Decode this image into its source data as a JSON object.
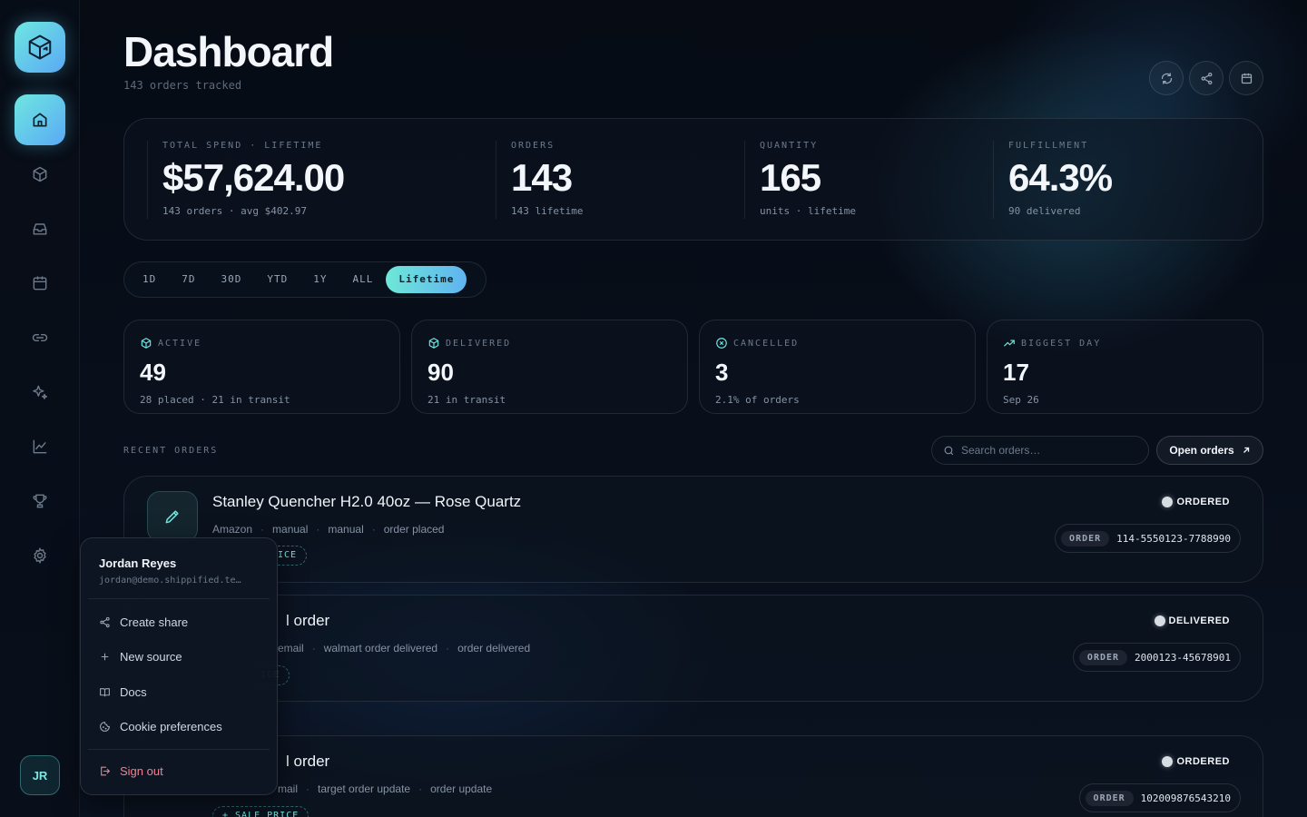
{
  "header": {
    "title": "Dashboard",
    "subtitle": "143 orders tracked"
  },
  "user": {
    "initials": "JR",
    "name": "Jordan Reyes",
    "email": "jordan@demo.shippified.te…"
  },
  "stats": [
    {
      "label": "TOTAL SPEND · LIFETIME",
      "value": "$57,624.00",
      "sub": "143 orders · avg $402.97"
    },
    {
      "label": "ORDERS",
      "value": "143",
      "sub": "143 lifetime"
    },
    {
      "label": "QUANTITY",
      "value": "165",
      "sub": "units · lifetime"
    },
    {
      "label": "FULFILLMENT",
      "value": "64.3%",
      "sub": "90 delivered"
    }
  ],
  "ranges": [
    "1D",
    "7D",
    "30D",
    "YTD",
    "1Y",
    "ALL",
    "Lifetime"
  ],
  "cards": [
    {
      "label": "ACTIVE",
      "value": "49",
      "sub": "28 placed · 21 in transit"
    },
    {
      "label": "DELIVERED",
      "value": "90",
      "sub": "21 in transit"
    },
    {
      "label": "CANCELLED",
      "value": "3",
      "sub": "2.1% of orders"
    },
    {
      "label": "BIGGEST DAY",
      "value": "17",
      "sub": "Sep 26"
    }
  ],
  "recent": {
    "title": "RECENT ORDERS",
    "search_placeholder": "Search orders…",
    "open_label": "Open orders"
  },
  "orders": [
    {
      "title": "Stanley Quencher H2.0 40oz — Rose Quartz",
      "meta": [
        "Amazon",
        "manual",
        "manual",
        "order placed"
      ],
      "tag": "+ SALE PRICE",
      "tag_visible": "ICE",
      "status": "ORDERED",
      "order_label": "ORDER",
      "order_no": "114-5550123-7788990"
    },
    {
      "title": "l order",
      "meta": [
        "email",
        "walmart order delivered",
        "order delivered"
      ],
      "tag_visible": "ICE",
      "status": "DELIVERED",
      "order_label": "ORDER",
      "order_no": "2000123-45678901"
    },
    {
      "title": "l order",
      "meta": [
        "mail",
        "target order update",
        "order update"
      ],
      "tag": "+ SALE PRICE",
      "status": "ORDERED",
      "order_label": "ORDER",
      "order_no": "102009876543210"
    }
  ],
  "menu": {
    "items": [
      "Create share",
      "New source",
      "Docs",
      "Cookie preferences"
    ],
    "signout": "Sign out"
  },
  "colors": {
    "accent": "#6ee7e0",
    "accent2": "#5aa9f5",
    "danger": "#f87f8f",
    "bg": "#070d17"
  }
}
